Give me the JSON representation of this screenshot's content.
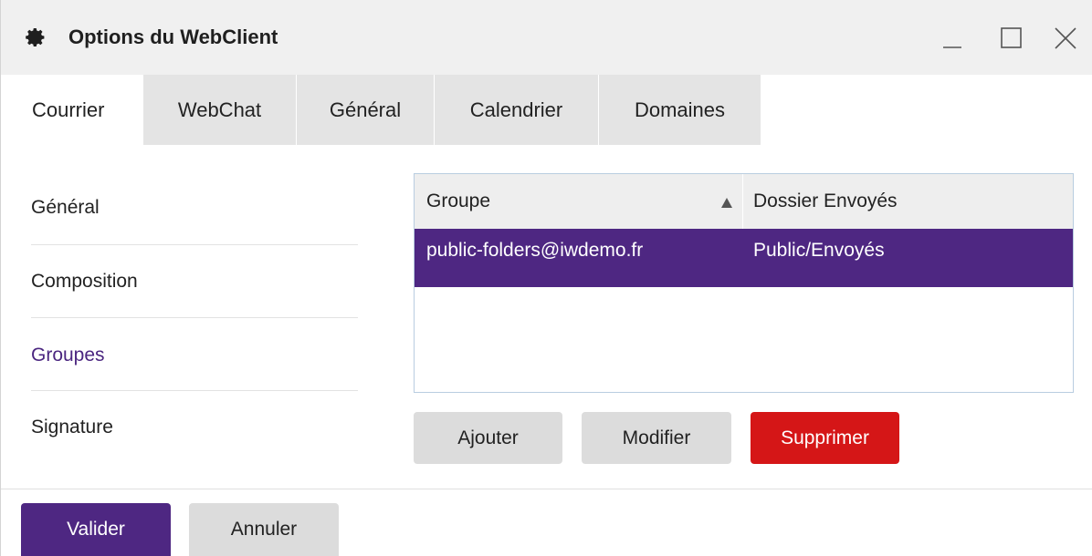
{
  "window": {
    "title": "Options du WebClient",
    "title_icon": "gear-icon",
    "controls": [
      "minimize-icon",
      "maximize-icon",
      "close-icon"
    ]
  },
  "tabs": [
    {
      "label": "Courrier",
      "active": true
    },
    {
      "label": "WebChat",
      "active": false
    },
    {
      "label": "Général",
      "active": false
    },
    {
      "label": "Calendrier",
      "active": false
    },
    {
      "label": "Domaines",
      "active": false
    }
  ],
  "sidebar": {
    "items": [
      {
        "label": "Général",
        "selected": false
      },
      {
        "label": "Composition",
        "selected": false
      },
      {
        "label": "Groupes",
        "selected": true
      },
      {
        "label": "Signature",
        "selected": false
      }
    ]
  },
  "table": {
    "columns": [
      "Groupe",
      "Dossier Envoyés"
    ],
    "sort": {
      "column": "Groupe",
      "direction": "ascending"
    },
    "rows": [
      {
        "group": "public-folders@iwdemo.fr",
        "folder": "Public/Envoyés",
        "selected": true
      }
    ]
  },
  "actions": {
    "add_label": "Ajouter",
    "edit_label": "Modifier",
    "delete_label": "Supprimer"
  },
  "footer": {
    "ok_label": "Valider",
    "cancel_label": "Annuler"
  },
  "colors": {
    "accent": "#4e2782",
    "danger": "#d51617",
    "titlebar": "#f0f0f0",
    "tab_inactive": "#e4e4e4",
    "button_grey": "#dcdcdc"
  }
}
